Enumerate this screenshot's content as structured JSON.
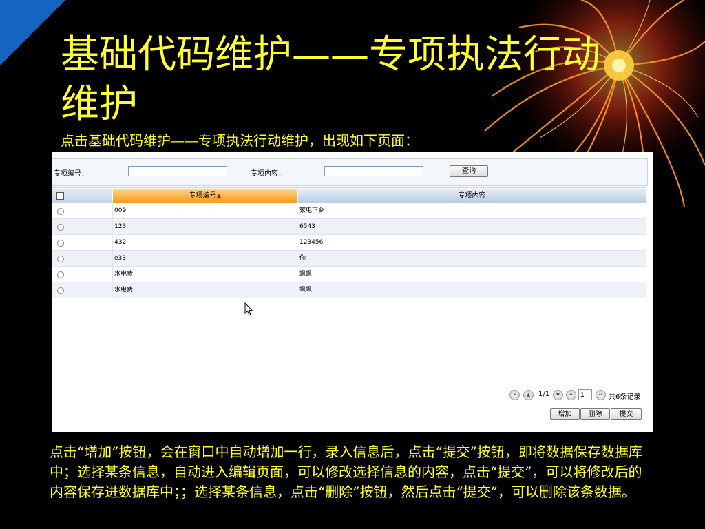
{
  "slide": {
    "title": "基础代码维护——专项执法行动维护",
    "subtitle": "点击基础代码维护——专项执法行动维护，出现如下页面：",
    "description": "点击“增加”按钮，会在窗口中自动增加一行，录入信息后，点击“提交”按钮，即将数据保存数据库中；选择某条信息，自动进入编辑页面，可以修改选择信息的内容，点击“提交”，可以将修改后的内容保存进数据库中；；选择某条信息，点击“删除”按钮，然后点击“提交”，可以删除该条数据。",
    "title_color": "#ffff33",
    "corner_color": "#1565c0"
  },
  "search": {
    "code_label": "专项编号：",
    "code_value": "",
    "content_label": "专项内容：",
    "content_value": "",
    "query_button": "查询"
  },
  "grid": {
    "columns": {
      "code": "专项编号",
      "content": "专项内容"
    },
    "sort_icon": "▲",
    "rows": [
      {
        "code": "009",
        "content": "家电下乡"
      },
      {
        "code": "123",
        "content": "6543"
      },
      {
        "code": "432",
        "content": "123456"
      },
      {
        "code": "e33",
        "content": "你"
      },
      {
        "code": "水电费",
        "content": "飒飒"
      },
      {
        "code": "水电费",
        "content": "飒飒"
      }
    ]
  },
  "pager": {
    "page_info": "1/1",
    "page_value": "1",
    "total": "共6条记录"
  },
  "actions": {
    "add": "增加",
    "delete": "删除",
    "submit": "提交"
  }
}
